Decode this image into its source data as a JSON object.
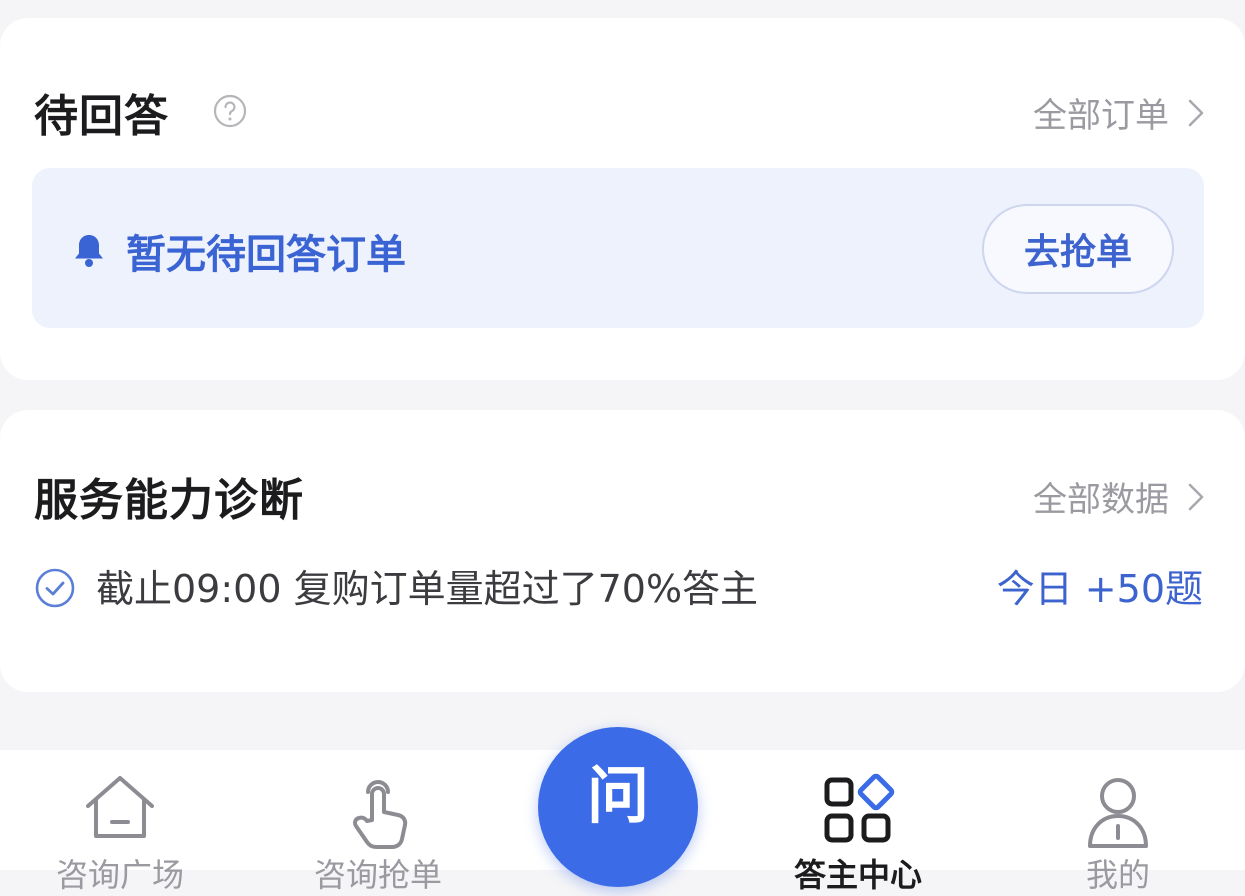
{
  "pending": {
    "title": "待回答",
    "link_label": "全部订单",
    "empty_text": "暂无待回答订单",
    "grab_button": "去抢单"
  },
  "service": {
    "title": "服务能力诊断",
    "link_label": "全部数据",
    "diagnosis_text": "截止09:00 复购订单量超过了70%答主",
    "today_text": "今日 +50题"
  },
  "nav": {
    "items": [
      {
        "label": "咨询广场",
        "icon": "home-icon"
      },
      {
        "label": "咨询抢单",
        "icon": "tap-hand-icon"
      },
      {
        "label": "问",
        "icon": "ask-button"
      },
      {
        "label": "答主中心",
        "icon": "grid-icon"
      },
      {
        "label": "我的",
        "icon": "user-icon"
      }
    ]
  },
  "colors": {
    "accent": "#3b6be6",
    "link_blue": "#3d63cf",
    "banner_bg": "#eef2fc",
    "muted": "#9a9aa0"
  }
}
